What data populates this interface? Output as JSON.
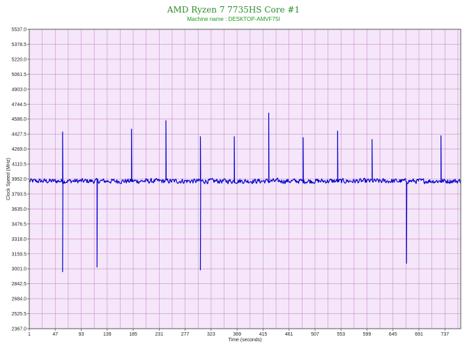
{
  "chart_data": {
    "type": "line",
    "title": "AMD Ryzen 7 7735HS Core #1",
    "subtitle": "Machine name : DESKTOP-AMVF75I",
    "xlabel": "Time (seconds)",
    "ylabel": "Clock Speed (MHz)",
    "xlim": [
      1,
      765
    ],
    "ylim": [
      2367.0,
      5537.0
    ],
    "xticks": [
      "1",
      "47",
      "93",
      "139",
      "185",
      "231",
      "277",
      "323",
      "369",
      "415",
      "461",
      "507",
      "553",
      "599",
      "645",
      "691",
      "737"
    ],
    "yticks": [
      "5537.0",
      "5378.5",
      "5220.0",
      "5061.5",
      "4903.0",
      "4744.5",
      "4586.0",
      "4427.5",
      "4269.0",
      "4110.5",
      "3952.0",
      "3793.5",
      "3635.0",
      "3476.5",
      "3318.0",
      "3159.5",
      "3001.0",
      "2842.5",
      "2684.0",
      "2525.5",
      "2367.0"
    ],
    "grid": true,
    "background": "#f5e6fa",
    "grid_color": "#c98dc9",
    "line_color": "#0000cc",
    "series": [
      {
        "baseline": 3930,
        "noise": 30,
        "spikes": [
          {
            "x": 60,
            "value": 4450
          },
          {
            "x": 60,
            "value": 2970
          },
          {
            "x": 121,
            "value": 3020
          },
          {
            "x": 182,
            "value": 4480
          },
          {
            "x": 243,
            "value": 4570
          },
          {
            "x": 304,
            "value": 4400
          },
          {
            "x": 304,
            "value": 2990
          },
          {
            "x": 364,
            "value": 4400
          },
          {
            "x": 425,
            "value": 4650
          },
          {
            "x": 486,
            "value": 4390
          },
          {
            "x": 547,
            "value": 4460
          },
          {
            "x": 608,
            "value": 4370
          },
          {
            "x": 669,
            "value": 3060
          },
          {
            "x": 730,
            "value": 4410
          }
        ]
      }
    ]
  }
}
